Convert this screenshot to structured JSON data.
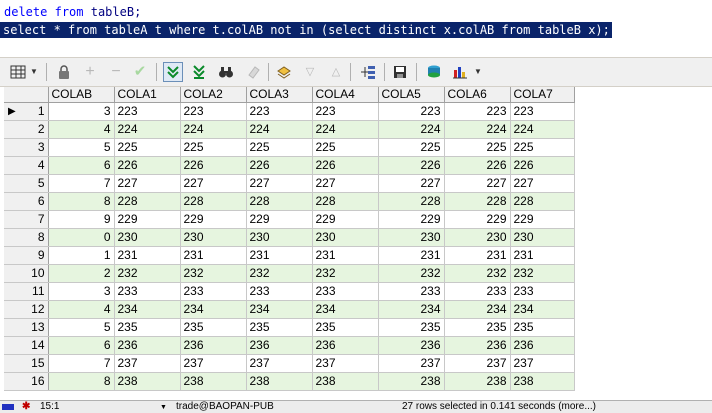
{
  "editor": {
    "line1": {
      "kw1": "delete",
      "kw2": "from",
      "rest": " tableB;"
    },
    "line2": "select * from tableA t where t.colAB not in (select distinct x.colAB from tableB x);"
  },
  "toolbar": {
    "icons": [
      "grid-view-icon",
      "lock-icon",
      "plus-icon",
      "minus-icon",
      "check-icon",
      "fetch-next-icon",
      "fetch-all-icon",
      "binoculars-icon",
      "eraser-icon",
      "export-icon",
      "move-down-icon",
      "move-up-icon",
      "query-by-example-icon",
      "save-icon",
      "print-icon",
      "chart-icon"
    ]
  },
  "grid": {
    "columns": [
      "COLAB",
      "COLA1",
      "COLA2",
      "COLA3",
      "COLA4",
      "COLA5",
      "COLA6",
      "COLA7"
    ],
    "rows": [
      {
        "n": "1",
        "colab": "3",
        "a1": "223",
        "a2": "223",
        "a3": "223",
        "a4": "223",
        "a5": "223",
        "a6": "223",
        "a7": "223"
      },
      {
        "n": "2",
        "colab": "4",
        "a1": "224",
        "a2": "224",
        "a3": "224",
        "a4": "224",
        "a5": "224",
        "a6": "224",
        "a7": "224"
      },
      {
        "n": "3",
        "colab": "5",
        "a1": "225",
        "a2": "225",
        "a3": "225",
        "a4": "225",
        "a5": "225",
        "a6": "225",
        "a7": "225"
      },
      {
        "n": "4",
        "colab": "6",
        "a1": "226",
        "a2": "226",
        "a3": "226",
        "a4": "226",
        "a5": "226",
        "a6": "226",
        "a7": "226"
      },
      {
        "n": "5",
        "colab": "7",
        "a1": "227",
        "a2": "227",
        "a3": "227",
        "a4": "227",
        "a5": "227",
        "a6": "227",
        "a7": "227"
      },
      {
        "n": "6",
        "colab": "8",
        "a1": "228",
        "a2": "228",
        "a3": "228",
        "a4": "228",
        "a5": "228",
        "a6": "228",
        "a7": "228"
      },
      {
        "n": "7",
        "colab": "9",
        "a1": "229",
        "a2": "229",
        "a3": "229",
        "a4": "229",
        "a5": "229",
        "a6": "229",
        "a7": "229"
      },
      {
        "n": "8",
        "colab": "0",
        "a1": "230",
        "a2": "230",
        "a3": "230",
        "a4": "230",
        "a5": "230",
        "a6": "230",
        "a7": "230"
      },
      {
        "n": "9",
        "colab": "1",
        "a1": "231",
        "a2": "231",
        "a3": "231",
        "a4": "231",
        "a5": "231",
        "a6": "231",
        "a7": "231"
      },
      {
        "n": "10",
        "colab": "2",
        "a1": "232",
        "a2": "232",
        "a3": "232",
        "a4": "232",
        "a5": "232",
        "a6": "232",
        "a7": "232"
      },
      {
        "n": "11",
        "colab": "3",
        "a1": "233",
        "a2": "233",
        "a3": "233",
        "a4": "233",
        "a5": "233",
        "a6": "233",
        "a7": "233"
      },
      {
        "n": "12",
        "colab": "4",
        "a1": "234",
        "a2": "234",
        "a3": "234",
        "a4": "234",
        "a5": "234",
        "a6": "234",
        "a7": "234"
      },
      {
        "n": "13",
        "colab": "5",
        "a1": "235",
        "a2": "235",
        "a3": "235",
        "a4": "235",
        "a5": "235",
        "a6": "235",
        "a7": "235"
      },
      {
        "n": "14",
        "colab": "6",
        "a1": "236",
        "a2": "236",
        "a3": "236",
        "a4": "236",
        "a5": "236",
        "a6": "236",
        "a7": "236"
      },
      {
        "n": "15",
        "colab": "7",
        "a1": "237",
        "a2": "237",
        "a3": "237",
        "a4": "237",
        "a5": "237",
        "a6": "237",
        "a7": "237"
      },
      {
        "n": "16",
        "colab": "8",
        "a1": "238",
        "a2": "238",
        "a3": "238",
        "a4": "238",
        "a5": "238",
        "a6": "238",
        "a7": "238"
      }
    ]
  },
  "status": {
    "position": "15:1",
    "connection": "trade@BAOPAN-PUB",
    "message": "27 rows selected in 0.141 seconds (more...)"
  }
}
